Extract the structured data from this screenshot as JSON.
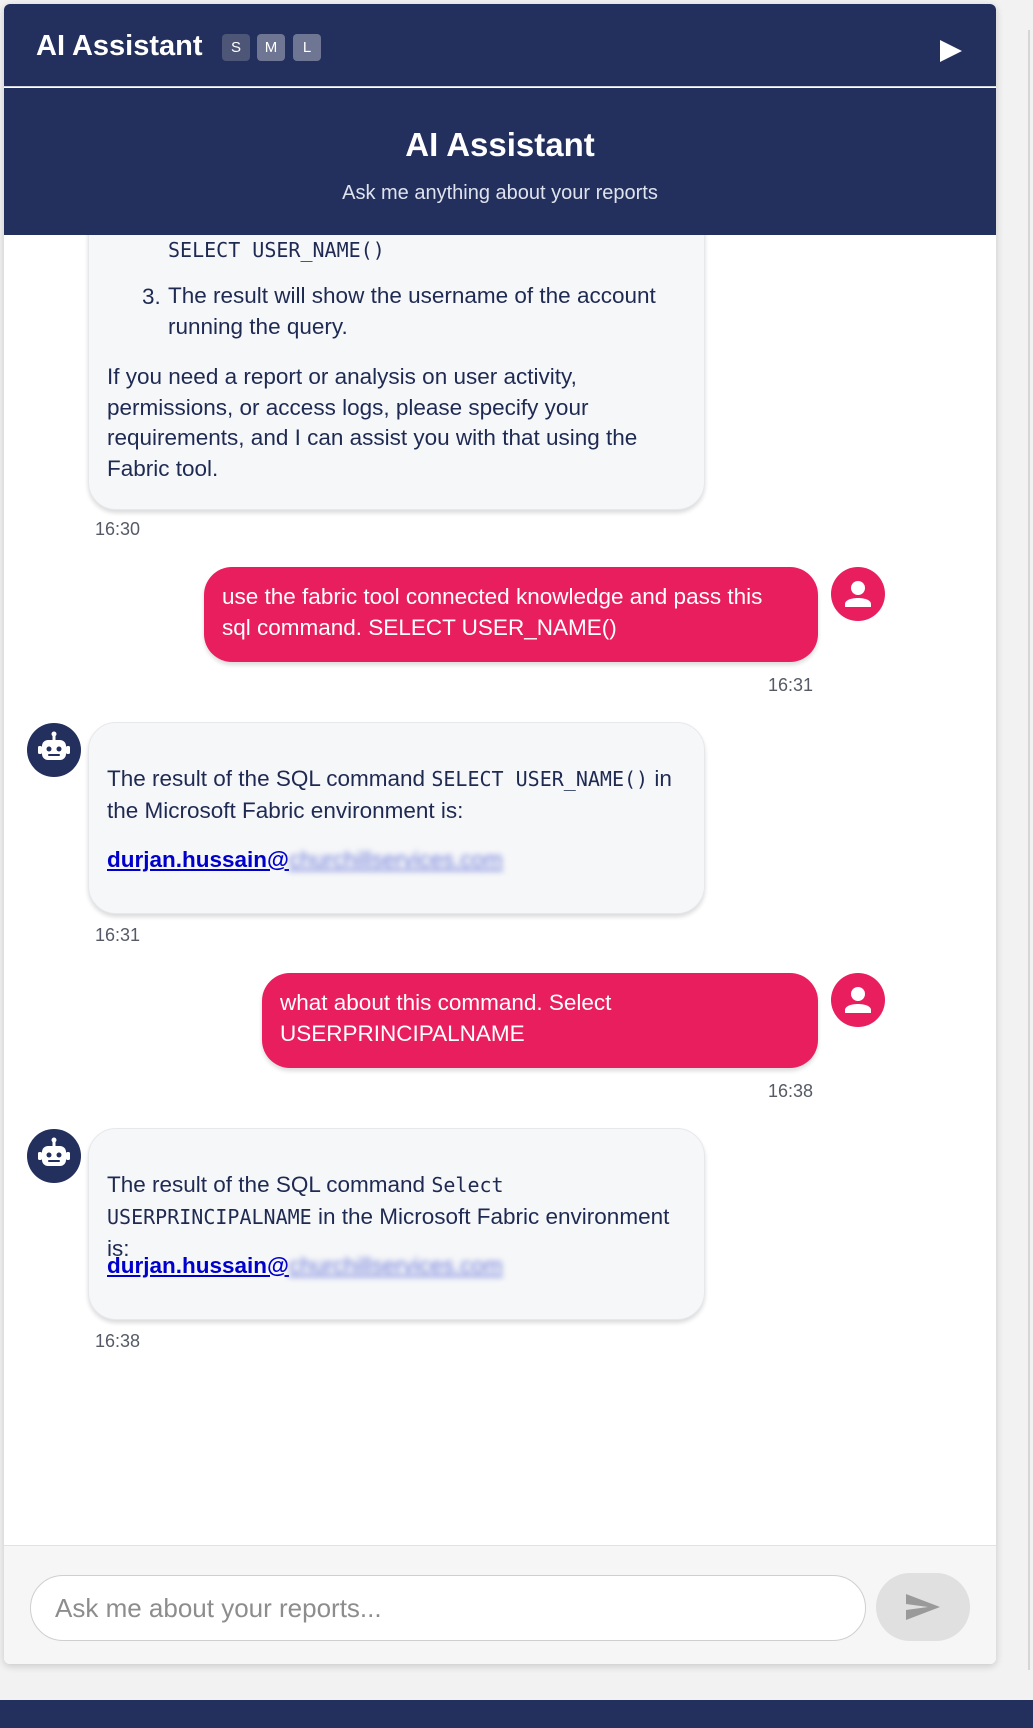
{
  "topbar": {
    "title": "AI Assistant",
    "sizes": [
      "S",
      "M",
      "L"
    ],
    "play_icon": "play-icon"
  },
  "header": {
    "title": "AI Assistant",
    "subtitle": "Ask me anything about your reports"
  },
  "messages": [
    {
      "role": "assistant",
      "code_line": "SELECT USER_NAME()",
      "list_number": "3.",
      "list_item": "The result will show the username of the account running the query.",
      "paragraph": "If you need a report or analysis on user activity, permissions, or access logs, please specify your requirements, and I can assist you with that using the Fabric tool.",
      "time": "16:30"
    },
    {
      "role": "user",
      "text": "use the fabric tool connected knowledge and pass this sql command. SELECT USER_NAME()",
      "time": "16:31"
    },
    {
      "role": "assistant",
      "text_before": "The result of the SQL command ",
      "code": "SELECT USER_NAME()",
      "text_after": " in the Microsoft Fabric environment is:",
      "email_visible": "durjan.hussain@",
      "email_blurred": "churchillservices.com",
      "time": "16:31"
    },
    {
      "role": "user",
      "text": "what about this command. Select USERPRINCIPALNAME",
      "time": "16:38"
    },
    {
      "role": "assistant",
      "text_before": "The result of the SQL command ",
      "code": "Select USERPRINCIPALNAME",
      "text_after": " in the Microsoft Fabric environment is:",
      "email_visible": "durjan.hussain@",
      "email_blurred": "churchillservices.com",
      "time": "16:38"
    }
  ],
  "input": {
    "placeholder": "Ask me about your reports...",
    "value": ""
  },
  "colors": {
    "navy": "#232f5c",
    "user_bubble": "#e91e5e",
    "bot_bubble": "#f6f7f9",
    "link": "#0000cc"
  }
}
